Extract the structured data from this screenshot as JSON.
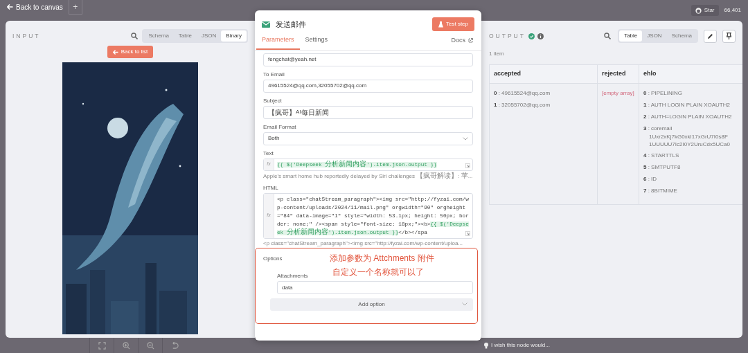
{
  "top_bar": {
    "back_label": "Back to canvas",
    "add_label": "+",
    "github": {
      "label": "Star",
      "count": "66,401"
    }
  },
  "input_panel": {
    "title": "INPUT",
    "view_tabs": [
      {
        "label": "Schema",
        "selected": false
      },
      {
        "label": "Table",
        "selected": false
      },
      {
        "label": "JSON",
        "selected": false
      },
      {
        "label": "Binary",
        "selected": true
      }
    ],
    "back_button": "Back to list"
  },
  "node_panel": {
    "title": "发送邮件",
    "test_button": "Test step",
    "tabs": [
      {
        "label": "Parameters",
        "selected": true
      },
      {
        "label": "Settings",
        "selected": false
      }
    ],
    "docs_label": "Docs",
    "fields": [
      {
        "kind": "input",
        "value": "fengchat@yeah.net"
      },
      {
        "kind": "input",
        "label": "To Email",
        "value": "49615524@qq.com,32055702@qq.com"
      },
      {
        "kind": "input",
        "label": "Subject",
        "value": "【疯哥】AI每日新闻"
      },
      {
        "kind": "select",
        "label": "Email Format",
        "value": "Both"
      },
      {
        "kind": "expression",
        "label": "Text",
        "prefix": "fx",
        "parts": [
          {
            "text": "{{ $('Deepseek 分析新闻内容').item.json.output }}",
            "expr": true
          }
        ],
        "preview": "Apple's smart home hub reportedly delayed by Siri challenges 【疯哥解读】: 苹..."
      },
      {
        "kind": "code",
        "label": "HTML",
        "prefix": "fx",
        "parts": [
          {
            "text": "<p class=\"chatStream_paragraph\"><img src=\"http://fyzai.com/wp-content/uploads/2024/11/mail.png\" orgwidth=\"90\" orgheight=\"84\" data-image=\"1\" style=\"width: 53.1px; height: 50px; border: none;\" /><span style=\"font-size: 18px;\">",
            "expr": false
          },
          {
            "text": "<b>",
            "expr": false
          },
          {
            "text": "{{ $('Deepseek 分析新闻内容').item.json.output }}",
            "expr": true
          },
          {
            "text": "</b></spa",
            "expr": false
          }
        ],
        "preview": "<p class=\"chatStream_paragraph\"><img src=\"http://fyzai.com/wp-content/uploa..."
      }
    ],
    "options": {
      "title": "Options",
      "items": [
        {
          "label": "Attachments",
          "value": "data"
        }
      ],
      "add_button": "Add option"
    },
    "annotation": {
      "lines": [
        "添加参数为 Attchments 附件",
        "自定义一个名称就可以了"
      ]
    }
  },
  "output_panel": {
    "title": "OUTPUT",
    "view_tabs": [
      {
        "label": "Table",
        "selected": true
      },
      {
        "label": "JSON",
        "selected": false
      },
      {
        "label": "Schema",
        "selected": false
      }
    ],
    "count_label": "1 item",
    "table": {
      "columns": [
        "accepted",
        "rejected",
        "ehlo"
      ],
      "rows": [
        {
          "cells": [
            {
              "kind": "list",
              "items": [
                {
                  "text": "**0** : 49615524@qq.com"
                },
                {
                  "text": "**1** : 32055702@qq.com"
                }
              ]
            },
            {
              "kind": "empty",
              "text": "[empty array]"
            },
            {
              "kind": "list",
              "items": [
                {
                  "text": "**0** : PIPELINING"
                },
                {
                  "text": "**1** : AUTH LOGIN PLAIN XOAUTH2"
                },
                {
                  "text": "**2** : AUTH=LOGIN PLAIN XOAUTH2"
                },
                {
                  "text": "**3** : coremail",
                  "more": [
                    "1Uxr2xKj7kG0xkI17xGrU7I0s8F",
                    "1UUUUU7Ic2I0Y2UruCdx5UCa0"
                  ]
                },
                {
                  "text": "**4** : STARTTLS"
                },
                {
                  "text": "**5** : SMTPUTF8"
                },
                {
                  "text": "**6** : ID"
                },
                {
                  "text": "**7** : 8BITMIME"
                }
              ]
            }
          ]
        }
      ]
    }
  },
  "footer": {
    "feedback": "I wish this node would..."
  }
}
